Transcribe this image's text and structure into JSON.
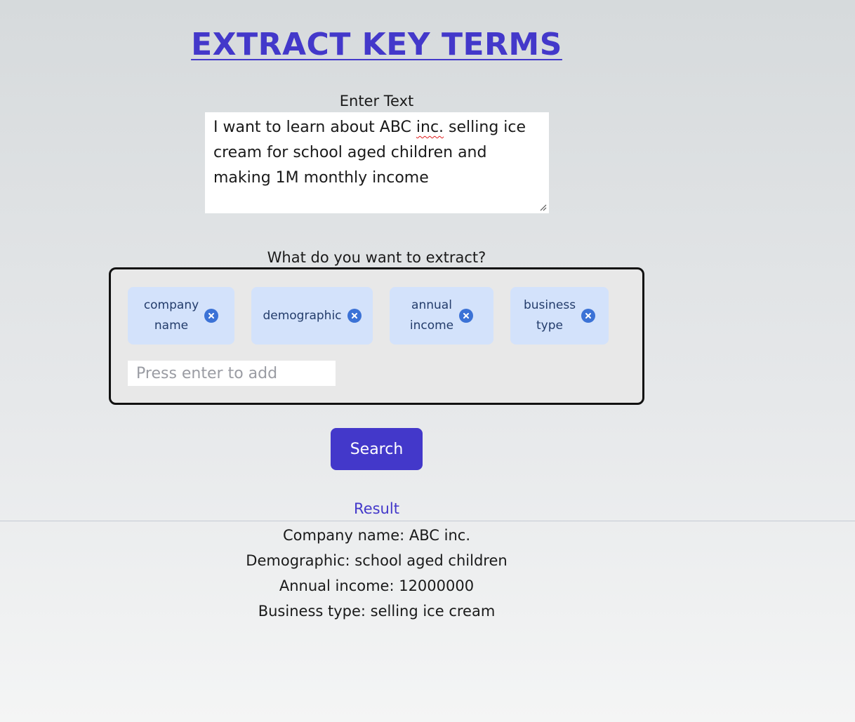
{
  "header": {
    "title": "EXTRACT KEY TERMS"
  },
  "input_section": {
    "label": "Enter Text",
    "text_before_flag": "I want to learn about ABC ",
    "flagged_word": "inc.",
    "text_after_flag": " selling ice cream for school aged children and making 1M monthly income"
  },
  "extract_section": {
    "label": "What do you want to extract?",
    "chips": [
      {
        "label": "company\nname",
        "remove_icon": "close-circle-icon"
      },
      {
        "label": "demographic",
        "remove_icon": "close-circle-icon"
      },
      {
        "label": "annual\nincome",
        "remove_icon": "close-circle-icon"
      },
      {
        "label": "business\ntype",
        "remove_icon": "close-circle-icon"
      }
    ],
    "add_input": {
      "placeholder": "Press enter to add",
      "value": ""
    }
  },
  "actions": {
    "search_label": "Search"
  },
  "result": {
    "heading": "Result",
    "lines": [
      "Company name: ABC inc.",
      "Demographic: school aged children",
      "Annual income: 12000000",
      "Business type: selling ice cream"
    ]
  },
  "colors": {
    "accent": "#4338ca",
    "chip_background": "#d3e2fb",
    "chip_remove": "#3b72d6",
    "spell_error": "#e11d1d"
  }
}
